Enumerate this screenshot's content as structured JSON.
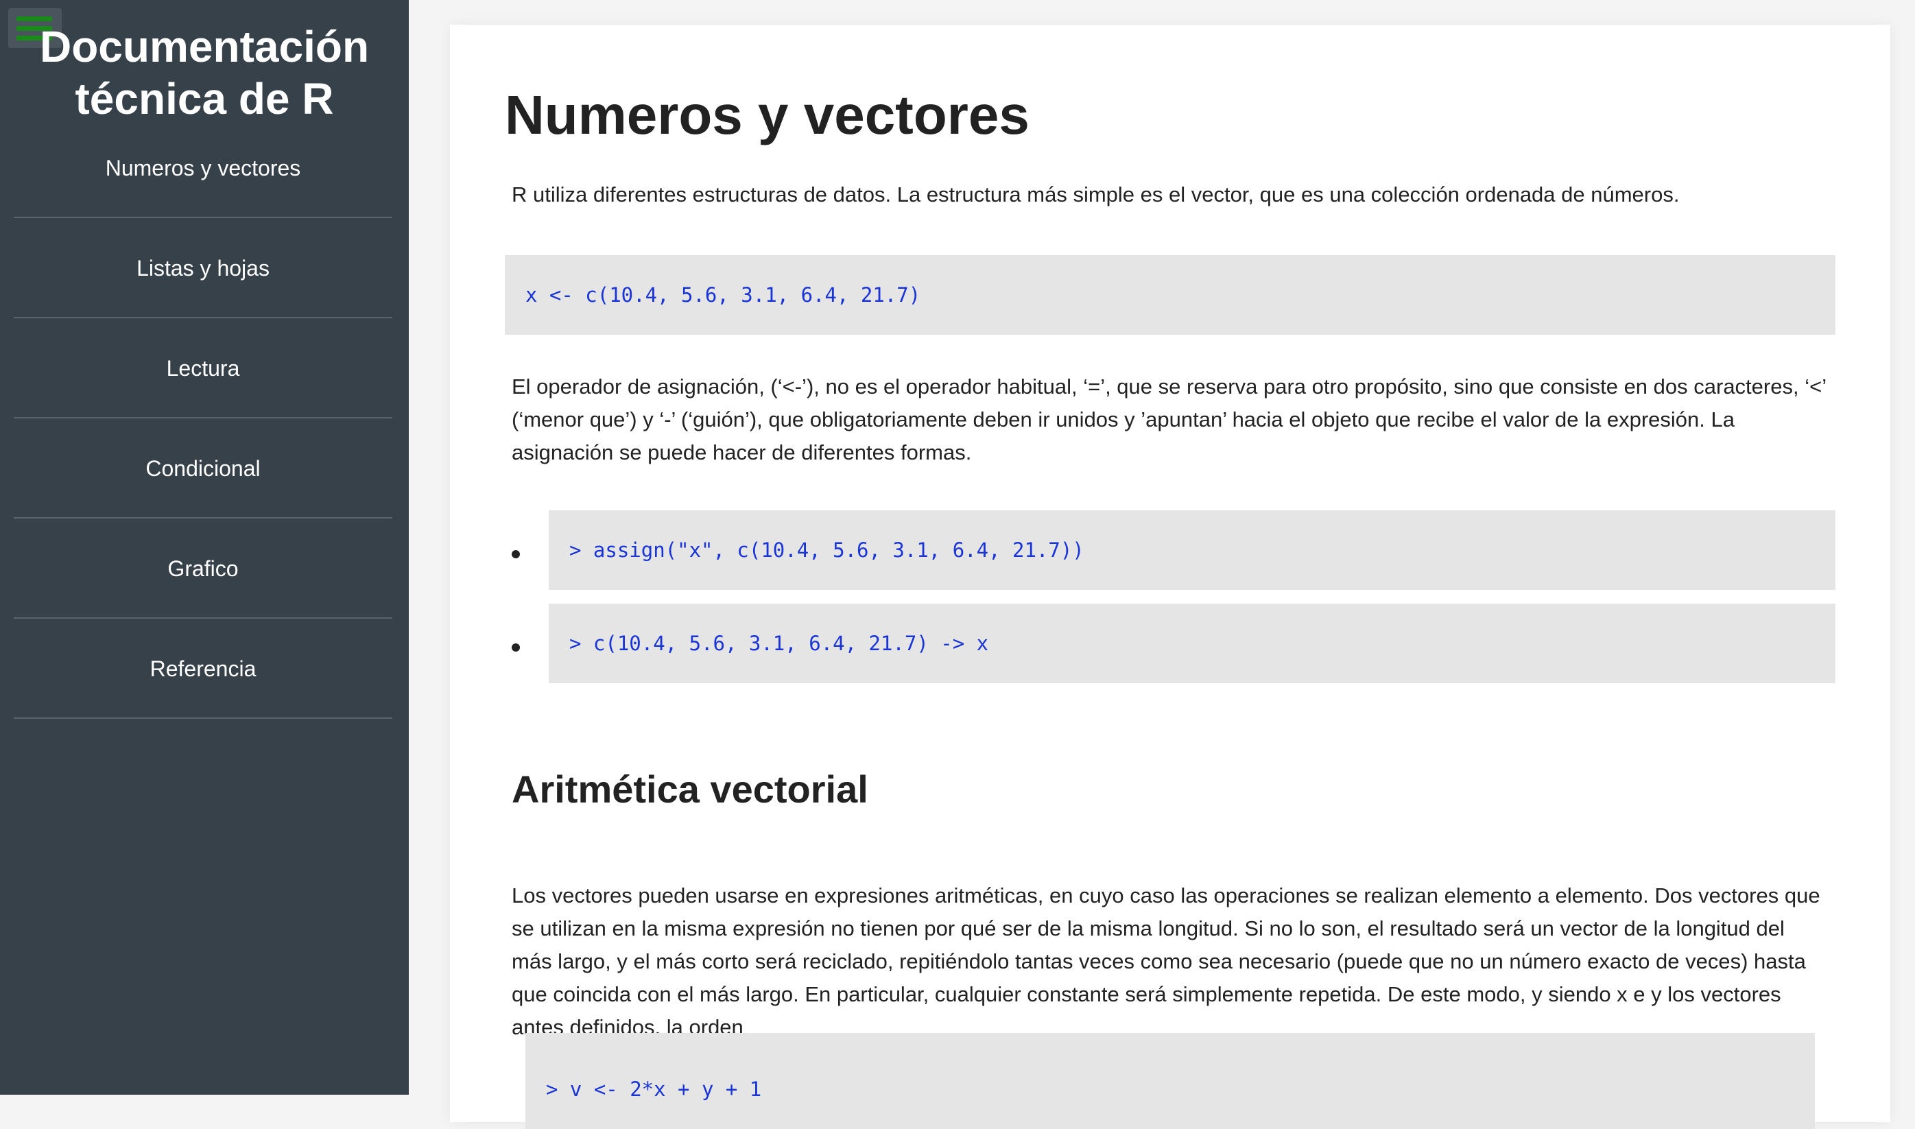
{
  "sidebar": {
    "title_line1": "Documentación",
    "title_line2": "técnica de R",
    "items": [
      {
        "label": "Numeros y vectores"
      },
      {
        "label": "Listas y hojas"
      },
      {
        "label": "Lectura"
      },
      {
        "label": "Condicional"
      },
      {
        "label": "Grafico"
      },
      {
        "label": "Referencia"
      }
    ]
  },
  "main": {
    "title": "Numeros y vectores",
    "intro": "R utiliza diferentes estructuras de datos. La estructura más simple es el vector, que es una colección ordenada de números.",
    "code1": "x <- c(10.4, 5.6, 3.1, 6.4, 21.7)",
    "assign_text": "El operador de asignación, (‘<-’), no es el operador habitual, ‘=’, que se reserva para otro propósito, sino que consiste en dos caracteres, ‘<’ (‘menor que’) y ‘-’ (‘guión’), que obligatoriamente deben ir unidos y ’apuntan’ hacia el objeto que recibe el valor de la expresión. La asignación se puede hacer de diferentes formas.",
    "list_code": [
      "> assign(\"x\", c(10.4, 5.6, 3.1, 6.4, 21.7))",
      "> c(10.4, 5.6, 3.1, 6.4, 21.7) -> x"
    ],
    "section_title": "Aritmética vectorial",
    "arith_text": "Los vectores pueden usarse en expresiones aritméticas, en cuyo caso las operaciones se realizan elemento a elemento. Dos vectores que se utilizan en la misma expresión no tienen por qué ser de la misma longitud. Si no lo son, el resultado será un vector de la longitud del más largo, y el más corto será reciclado, repitiéndolo tantas veces como sea necesario (puede que no un número exacto de veces) hasta que coincida con el más largo. En particular, cualquier constante será simplemente repetida. De este modo, y siendo x e y los vectores antes definidos, la orden",
    "code_last": "> v <- 2*x + y + 1"
  },
  "colors": {
    "sidebar_bg": "#37414a",
    "code_bg": "#e5e5e5",
    "code_text": "#1a35d6",
    "menu_icon": "#1a8a1a"
  }
}
